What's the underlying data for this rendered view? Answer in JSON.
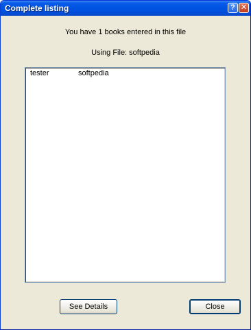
{
  "window": {
    "title": "Complete listing",
    "help_glyph": "?",
    "close_glyph": "✕"
  },
  "main": {
    "count_message": "You have 1 books entered in this file",
    "file_message": "Using File: softpedia"
  },
  "list": {
    "rows": [
      {
        "col1": "tester",
        "col2": "softpedia"
      }
    ]
  },
  "buttons": {
    "see_details_label": "See Details",
    "close_label": "Close"
  },
  "colors": {
    "titlebar": "#0054e3",
    "dialog_background": "#ece9d8",
    "button_border": "#003c74"
  }
}
